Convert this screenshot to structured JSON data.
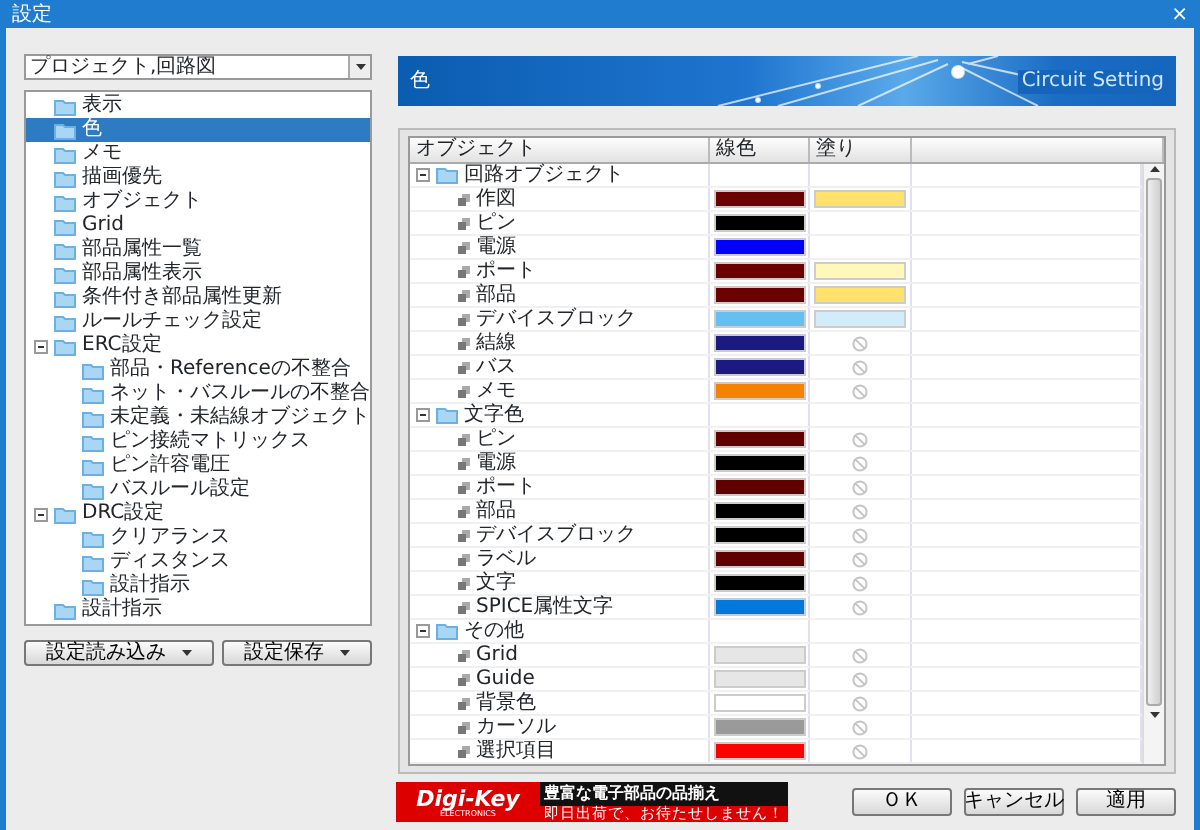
{
  "window": {
    "title": "設定",
    "close": "×"
  },
  "project_select": {
    "value": "プロジェクト,回路図"
  },
  "sidebar": {
    "items": [
      {
        "label": "表示",
        "selected": false
      },
      {
        "label": "色",
        "selected": true
      },
      {
        "label": "メモ",
        "selected": false
      },
      {
        "label": "描画優先",
        "selected": false
      },
      {
        "label": "オブジェクト",
        "selected": false
      },
      {
        "label": "Grid",
        "selected": false
      },
      {
        "label": "部品属性一覧",
        "selected": false
      },
      {
        "label": "部品属性表示",
        "selected": false
      },
      {
        "label": "条件付き部品属性更新",
        "selected": false
      },
      {
        "label": "ルールチェック設定",
        "selected": false
      },
      {
        "label": "ERC設定",
        "selected": false,
        "expanded": true,
        "children": [
          {
            "label": "部品・Referenceの不整合",
            "selected": false
          },
          {
            "label": "ネット・バスルールの不整合",
            "selected": false
          },
          {
            "label": "未定義・未結線オブジェクト",
            "selected": false
          },
          {
            "label": "ピン接続マトリックス",
            "selected": false
          },
          {
            "label": "ピン許容電圧",
            "selected": false
          },
          {
            "label": "バスルール設定",
            "selected": false
          }
        ]
      },
      {
        "label": "DRC設定",
        "selected": false,
        "expanded": true,
        "children": [
          {
            "label": "クリアランス",
            "selected": false
          },
          {
            "label": "ディスタンス",
            "selected": false
          },
          {
            "label": "設計指示",
            "selected": false
          }
        ]
      },
      {
        "label": "設計指示",
        "selected": false
      }
    ]
  },
  "left_buttons": [
    "設定読み込み",
    "設定保存"
  ],
  "banner": {
    "title": "色",
    "subtitle": "Circuit Setting"
  },
  "table": {
    "columns": [
      "オブジェクト",
      "線色",
      "塗り"
    ],
    "groups": [
      {
        "label": "回路オブジェクト",
        "expanded": true,
        "items": [
          {
            "label": "作図",
            "color": "#6b0000",
            "fill": {
              "kind": "swatch",
              "color": "#ffe16b"
            }
          },
          {
            "label": "ピン",
            "color": "#000000"
          },
          {
            "label": "電源",
            "color": "#0000ff"
          },
          {
            "label": "ポート",
            "color": "#6b0000",
            "fill": {
              "kind": "swatch",
              "color": "#fff8b8"
            }
          },
          {
            "label": "部品",
            "color": "#6b0000",
            "fill": {
              "kind": "swatch",
              "color": "#ffe16b"
            }
          },
          {
            "label": "デバイスブロック",
            "color": "#64c0f0",
            "fill": {
              "kind": "swatch",
              "color": "#d2ecfa"
            }
          },
          {
            "label": "結線",
            "color": "#1a1a80",
            "fill": {
              "kind": "none"
            }
          },
          {
            "label": "バス",
            "color": "#1a1a80",
            "fill": {
              "kind": "none"
            }
          },
          {
            "label": "メモ",
            "color": "#f58200",
            "fill": {
              "kind": "none"
            }
          }
        ]
      },
      {
        "label": "文字色",
        "expanded": true,
        "items": [
          {
            "label": "ピン",
            "color": "#600000",
            "fill": {
              "kind": "none"
            }
          },
          {
            "label": "電源",
            "color": "#000000",
            "fill": {
              "kind": "none"
            }
          },
          {
            "label": "ポート",
            "color": "#600000",
            "fill": {
              "kind": "none"
            }
          },
          {
            "label": "部品",
            "color": "#000000",
            "fill": {
              "kind": "none"
            }
          },
          {
            "label": "デバイスブロック",
            "color": "#000000",
            "fill": {
              "kind": "none"
            }
          },
          {
            "label": "ラベル",
            "color": "#600000",
            "fill": {
              "kind": "none"
            }
          },
          {
            "label": "文字",
            "color": "#000000",
            "fill": {
              "kind": "none"
            }
          },
          {
            "label": "SPICE属性文字",
            "color": "#0078dc",
            "fill": {
              "kind": "none"
            }
          }
        ]
      },
      {
        "label": "その他",
        "expanded": true,
        "items": [
          {
            "label": "Grid",
            "color": "#e6e6e6",
            "fill": {
              "kind": "none"
            }
          },
          {
            "label": "Guide",
            "color": "#e6e6e6",
            "fill": {
              "kind": "none"
            }
          },
          {
            "label": "背景色",
            "color": "#ffffff",
            "fill": {
              "kind": "none"
            }
          },
          {
            "label": "カーソル",
            "color": "#9a9a9a",
            "fill": {
              "kind": "none"
            }
          },
          {
            "label": "選択項目",
            "color": "#ff0000",
            "fill": {
              "kind": "none"
            }
          }
        ]
      }
    ]
  },
  "ad": {
    "logo": "Digi-Key",
    "logo_sub": "ELECTRONICS",
    "headline": "豊富な電子部品の品揃え",
    "tagline": "即日出荷で、お待たせしません！"
  },
  "dialog_buttons": [
    "ＯＫ",
    "キャンセル",
    "適用"
  ]
}
